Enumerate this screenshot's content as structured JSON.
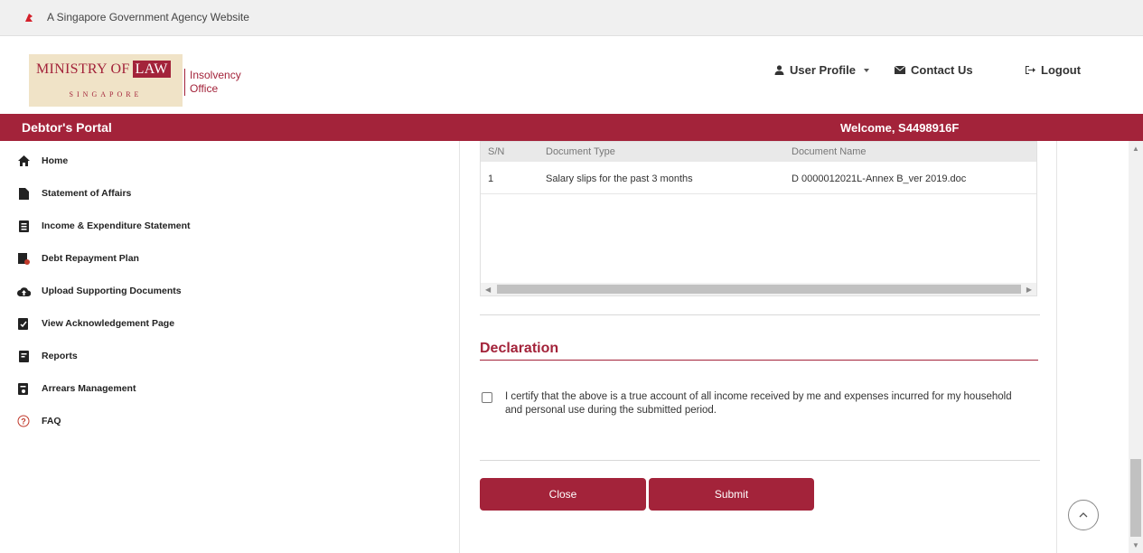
{
  "gov_banner": {
    "text": "A Singapore Government Agency Website"
  },
  "logo": {
    "main": "MINISTRY OF",
    "law": "LAW",
    "country": "SINGAPORE",
    "office_line1": "Insolvency",
    "office_line2": "Office"
  },
  "top_nav": {
    "user_profile": "User Profile",
    "contact_us": "Contact Us",
    "logout": "Logout"
  },
  "portal": {
    "title": "Debtor's Portal",
    "welcome": "Welcome, S4498916F"
  },
  "sidebar": {
    "items": [
      {
        "label": "Home",
        "icon": "home-icon"
      },
      {
        "label": "Statement of Affairs",
        "icon": "document-icon"
      },
      {
        "label": "Income & Expenditure Statement",
        "icon": "statement-icon"
      },
      {
        "label": "Debt Repayment Plan",
        "icon": "plan-icon"
      },
      {
        "label": "Upload Supporting Documents",
        "icon": "cloud-upload-icon"
      },
      {
        "label": "View Acknowledgement Page",
        "icon": "acknowledgement-icon"
      },
      {
        "label": "Reports",
        "icon": "report-icon"
      },
      {
        "label": "Arrears Management",
        "icon": "arrears-icon"
      },
      {
        "label": "FAQ",
        "icon": "question-icon"
      }
    ]
  },
  "documents_table": {
    "headers": {
      "sn": "S/N",
      "type": "Document Type",
      "name": "Document Name"
    },
    "rows": [
      {
        "sn": "1",
        "type": "Salary slips for the past 3 months",
        "name": "D 0000012021L-Annex B_ver 2019.doc"
      }
    ]
  },
  "declaration": {
    "title": "Declaration",
    "text": "I certify that the above is a true account of all income received by me and expenses incurred for my household and personal use during the submitted period.",
    "checked": false
  },
  "buttons": {
    "close": "Close",
    "submit": "Submit"
  },
  "colors": {
    "brand": "#a3233a",
    "logo_bg": "#f0e3c7"
  }
}
